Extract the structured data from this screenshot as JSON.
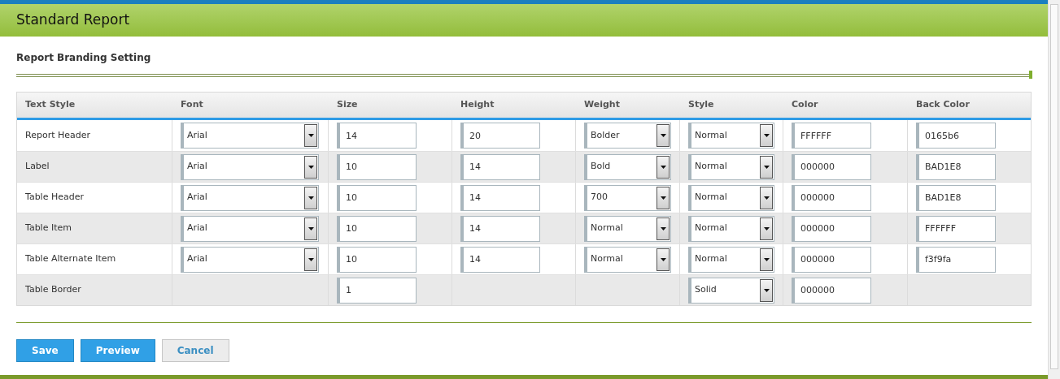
{
  "page_title": "Standard Report",
  "section_title": "Report Branding Setting",
  "table": {
    "columns": [
      "Text Style",
      "Font",
      "Size",
      "Height",
      "Weight",
      "Style",
      "Color",
      "Back Color"
    ],
    "rows": [
      {
        "cells": [
          {
            "kind": "text",
            "value": "Report Header"
          },
          {
            "kind": "select",
            "value": "Arial"
          },
          {
            "kind": "input",
            "value": "14"
          },
          {
            "kind": "input",
            "value": "20"
          },
          {
            "kind": "select",
            "value": "Bolder"
          },
          {
            "kind": "select",
            "value": "Normal"
          },
          {
            "kind": "input",
            "value": "FFFFFF"
          },
          {
            "kind": "input",
            "value": "0165b6"
          }
        ]
      },
      {
        "cells": [
          {
            "kind": "text",
            "value": "Label"
          },
          {
            "kind": "select",
            "value": "Arial"
          },
          {
            "kind": "input",
            "value": "10"
          },
          {
            "kind": "input",
            "value": "14"
          },
          {
            "kind": "select",
            "value": "Bold"
          },
          {
            "kind": "select",
            "value": "Normal"
          },
          {
            "kind": "input",
            "value": "000000"
          },
          {
            "kind": "input",
            "value": "BAD1E8"
          }
        ]
      },
      {
        "cells": [
          {
            "kind": "text",
            "value": "Table Header"
          },
          {
            "kind": "select",
            "value": "Arial"
          },
          {
            "kind": "input",
            "value": "10"
          },
          {
            "kind": "input",
            "value": "14"
          },
          {
            "kind": "select",
            "value": "700"
          },
          {
            "kind": "select",
            "value": "Normal"
          },
          {
            "kind": "input",
            "value": "000000"
          },
          {
            "kind": "input",
            "value": "BAD1E8"
          }
        ]
      },
      {
        "cells": [
          {
            "kind": "text",
            "value": "Table Item"
          },
          {
            "kind": "select",
            "value": "Arial"
          },
          {
            "kind": "input",
            "value": "10"
          },
          {
            "kind": "input",
            "value": "14"
          },
          {
            "kind": "select",
            "value": "Normal"
          },
          {
            "kind": "select",
            "value": "Normal"
          },
          {
            "kind": "input",
            "value": "000000"
          },
          {
            "kind": "input",
            "value": "FFFFFF"
          }
        ]
      },
      {
        "cells": [
          {
            "kind": "text",
            "value": "Table Alternate Item"
          },
          {
            "kind": "select",
            "value": "Arial"
          },
          {
            "kind": "input",
            "value": "10"
          },
          {
            "kind": "input",
            "value": "14"
          },
          {
            "kind": "select",
            "value": "Normal"
          },
          {
            "kind": "select",
            "value": "Normal"
          },
          {
            "kind": "input",
            "value": "000000"
          },
          {
            "kind": "input",
            "value": "f3f9fa"
          }
        ]
      },
      {
        "cells": [
          {
            "kind": "text",
            "value": "Table Border"
          },
          {
            "kind": "blank"
          },
          {
            "kind": "input",
            "value": "1"
          },
          {
            "kind": "blank"
          },
          {
            "kind": "blank"
          },
          {
            "kind": "select",
            "value": "Solid"
          },
          {
            "kind": "input",
            "value": "000000"
          },
          {
            "kind": "blank"
          }
        ]
      }
    ]
  },
  "buttons": [
    {
      "label": "Save",
      "kind": "primary"
    },
    {
      "label": "Preview",
      "kind": "primary"
    },
    {
      "label": "Cancel",
      "kind": "secondary"
    }
  ]
}
